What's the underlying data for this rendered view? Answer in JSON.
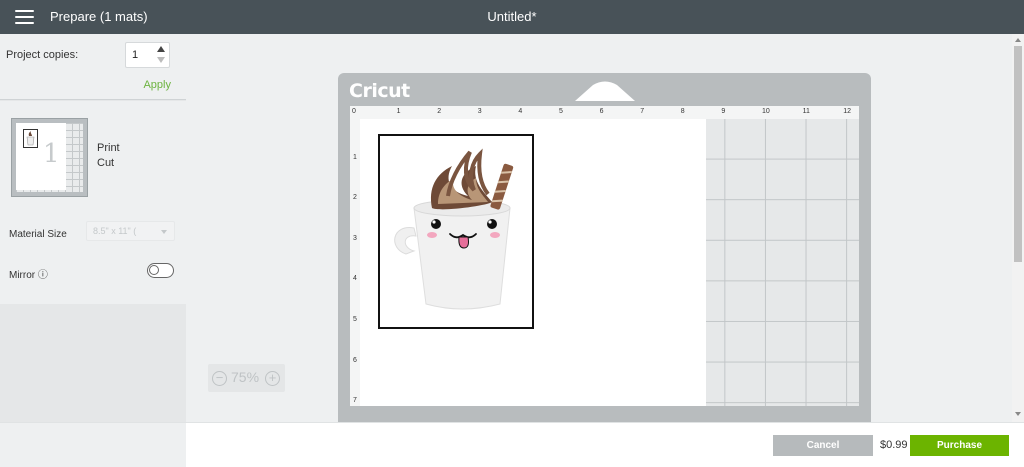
{
  "header": {
    "menu_icon": "hamburger-icon",
    "title": "Prepare (1 mats)",
    "document_title": "Untitled*"
  },
  "sidebar": {
    "copies_label": "Project copies:",
    "copies_value": "1",
    "apply_label": "Apply",
    "mat": {
      "number": "1",
      "print_label": "Print",
      "cut_label": "Cut"
    },
    "material_size_label": "Material Size",
    "material_size_value": "8.5\" x 11\" (",
    "mirror_label": "Mirror ⓘ",
    "mirror_enabled": false
  },
  "zoom": {
    "value": "75%",
    "minus": "−",
    "plus": "+"
  },
  "mat_view": {
    "brand": "Cricut",
    "ruler_top": [
      "0",
      "1",
      "2",
      "3",
      "4",
      "5",
      "6",
      "7",
      "8",
      "9",
      "10",
      "11",
      "12"
    ],
    "ruler_left": [
      "1",
      "2",
      "3",
      "4",
      "5",
      "6",
      "7"
    ]
  },
  "footer": {
    "cancel_label": "Cancel",
    "price": "$0.99",
    "purchase_label": "Purchase"
  },
  "colors": {
    "topbar": "#485258",
    "accent_green": "#6cb400",
    "apply_green": "#6cb33f",
    "cancel_gray": "#b6babc"
  }
}
